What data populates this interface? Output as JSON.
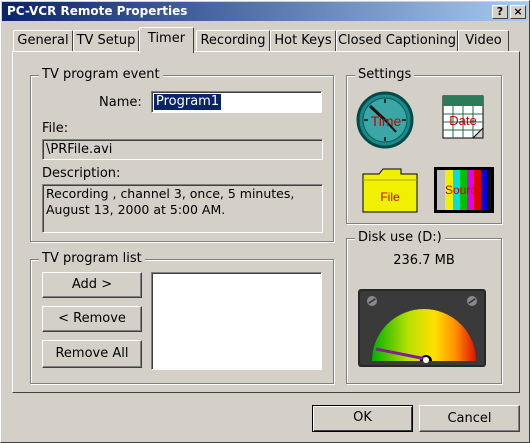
{
  "window": {
    "title": "PC-VCR Remote Properties",
    "help_label": "?",
    "close_label": "×"
  },
  "tabs": [
    {
      "label": "General"
    },
    {
      "label": "TV Setup"
    },
    {
      "label": "Timer"
    },
    {
      "label": "Recording"
    },
    {
      "label": "Hot Keys"
    },
    {
      "label": "Closed Captioning"
    },
    {
      "label": "Video"
    }
  ],
  "event": {
    "group_label": "TV program event",
    "name_label": "Name:",
    "name_value": "Program1",
    "file_label": "File:",
    "file_value": "\\PRFile.avi",
    "description_label": "Description:",
    "description_value": "Recording , channel 3, once, 5 minutes, August 13, 2000 at 5:00 AM."
  },
  "program_list": {
    "group_label": "TV program list",
    "add_label": "Add >",
    "remove_label": "< Remove",
    "remove_all_label": "Remove All",
    "items": []
  },
  "settings": {
    "group_label": "Settings",
    "time_label": "Time",
    "date_label": "Date",
    "file_label": "File",
    "source_label": "Source",
    "icons": [
      "clock-icon",
      "calendar-icon",
      "folder-icon",
      "color-bars-icon"
    ]
  },
  "disk": {
    "group_label": "Disk use (D:)",
    "value": "236.7 MB"
  },
  "footer": {
    "ok_label": "OK",
    "cancel_label": "Cancel"
  },
  "colors": {
    "title_start": "#0a246a",
    "title_end": "#a6caf0",
    "selection": "#0a246a",
    "label_red": "#cc0000"
  }
}
